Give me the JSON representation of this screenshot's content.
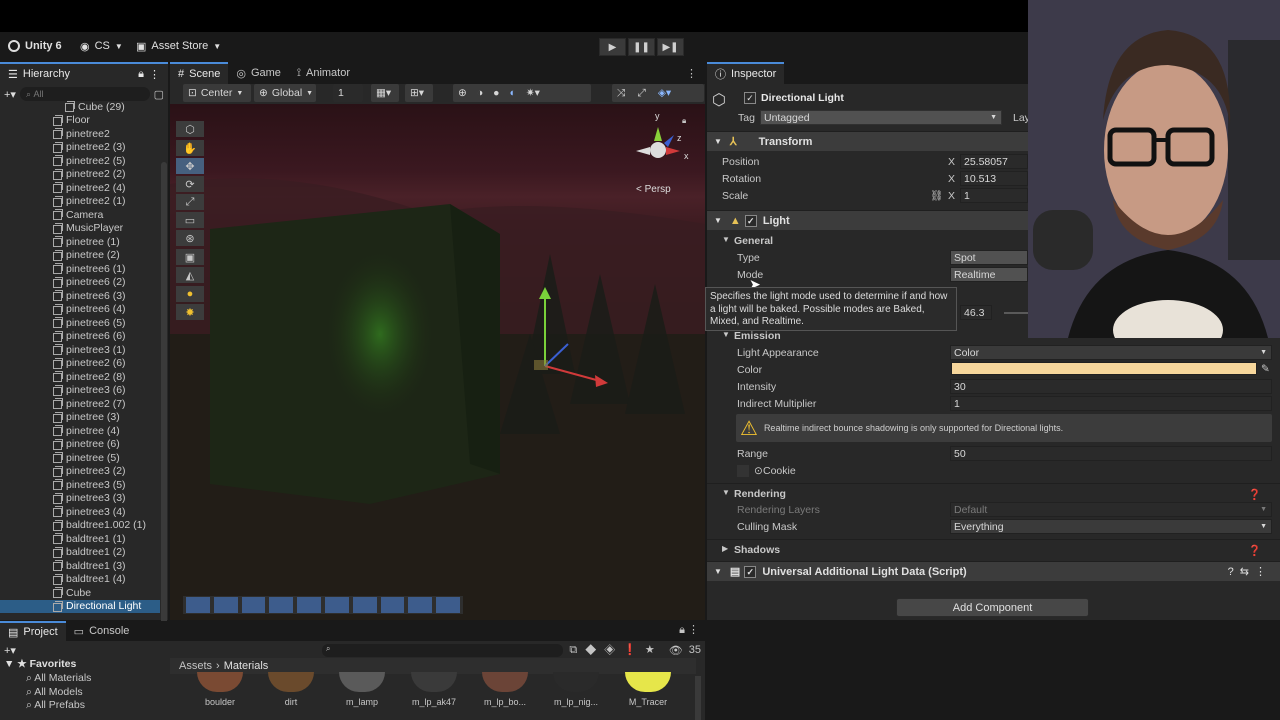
{
  "toolbar": {
    "brand": "Unity 6",
    "account": "CS",
    "asset_store": "Asset Store"
  },
  "hierarchy": {
    "title": "Hierarchy",
    "search_placeholder": "All",
    "items": [
      "Cube (29)",
      "Floor",
      "pinetree2",
      "pinetree2 (3)",
      "pinetree2 (5)",
      "pinetree2 (2)",
      "pinetree2 (4)",
      "pinetree2 (1)",
      "Camera",
      "MusicPlayer",
      "pinetree (1)",
      "pinetree (2)",
      "pinetree6 (1)",
      "pinetree6 (2)",
      "pinetree6 (3)",
      "pinetree6 (4)",
      "pinetree6 (5)",
      "pinetree6 (6)",
      "pinetree3 (1)",
      "pinetree2 (6)",
      "pinetree2 (8)",
      "pinetree3 (6)",
      "pinetree2 (7)",
      "pinetree (3)",
      "pinetree (4)",
      "pinetree (6)",
      "pinetree (5)",
      "pinetree3 (2)",
      "pinetree3 (5)",
      "pinetree3 (3)",
      "pinetree3 (4)",
      "baldtree1.002 (1)",
      "baldtree1 (1)",
      "baldtree1 (2)",
      "baldtree1 (3)",
      "baldtree1 (4)",
      "Cube",
      "Directional Light"
    ],
    "selected": "Directional Light"
  },
  "scene": {
    "tabs": [
      "Scene",
      "Game",
      "Animator"
    ],
    "pivot": "Center",
    "space": "Global",
    "grid_value": "1",
    "persp_label": "< Persp",
    "gizmo_axes": {
      "y": "y",
      "x": "x",
      "z": "z"
    }
  },
  "inspector": {
    "title": "Inspector",
    "object_name": "Directional Light",
    "tag_label": "Tag",
    "tag_value": "Untagged",
    "layer_label": "Lay",
    "transform": {
      "title": "Transform",
      "position_label": "Position",
      "rotation_label": "Rotation",
      "scale_label": "Scale",
      "axis": "X",
      "position_x": "25.58057",
      "rotation_x": "10.513",
      "scale_x": "1"
    },
    "light": {
      "title": "Light",
      "general": "General",
      "type_label": "Type",
      "type_value": "Spot",
      "mode_label": "Mode",
      "mode_value": "Realtime",
      "angle_value": "46.3",
      "tooltip": "Specifies the light mode used to determine if and how a light will be baked. Possible modes are Baked, Mixed, and Realtime.",
      "emission": "Emission",
      "appearance_label": "Light Appearance",
      "appearance_value": "Color",
      "color_label": "Color",
      "color_value": "#f7d79c",
      "intensity_label": "Intensity",
      "intensity_value": "30",
      "indirect_label": "Indirect Multiplier",
      "indirect_value": "1",
      "warning": "Realtime indirect bounce shadowing is only supported for Directional lights.",
      "range_label": "Range",
      "range_value": "50",
      "cookie_label": "Cookie",
      "rendering": "Rendering",
      "layers_label": "Rendering Layers",
      "layers_value": "Default",
      "culling_label": "Culling Mask",
      "culling_value": "Everything",
      "shadows": "Shadows"
    },
    "script_component": "Universal Additional Light Data (Script)",
    "add_component": "Add Component"
  },
  "project": {
    "tabs": [
      "Project",
      "Console"
    ],
    "favorites": "Favorites",
    "fav_items": [
      "All Materials",
      "All Models",
      "All Prefabs"
    ],
    "breadcrumb_root": "Assets",
    "breadcrumb_leaf": "Materials",
    "count": "35",
    "assets": [
      {
        "name": "boulder",
        "color": "#7a4a33"
      },
      {
        "name": "dirt",
        "color": "#6a4a2c"
      },
      {
        "name": "m_lamp",
        "color": "#5a5a5a"
      },
      {
        "name": "m_lp_ak47",
        "color": "#3a3a3a"
      },
      {
        "name": "m_lp_bo...",
        "color": "#6b4437"
      },
      {
        "name": "m_lp_nig...",
        "color": "#2a2a2a"
      },
      {
        "name": "M_Tracer",
        "color": "#e6e64a"
      }
    ]
  }
}
